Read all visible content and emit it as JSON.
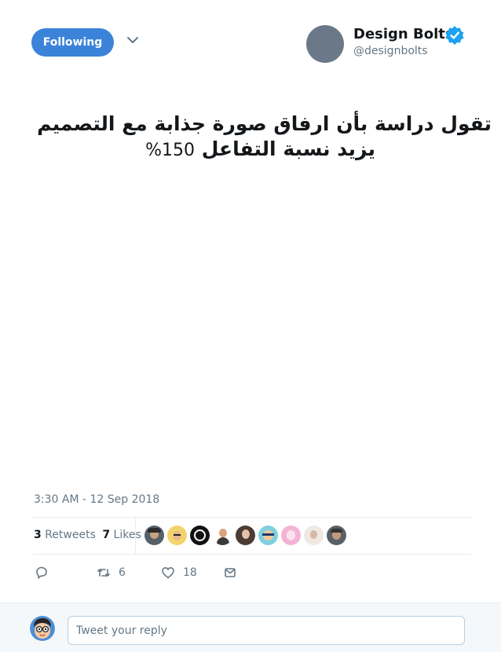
{
  "header": {
    "follow_button_label": "Following",
    "author": {
      "name": "Design Bolts",
      "handle": "@designbolts",
      "verified": true
    }
  },
  "tweet": {
    "text_line1": "تقول دراسة بأن ارفاق صورة جذابة مع التصميم",
    "text_line2": "يزيد نسبة التفاعل",
    "text_percent": "150%",
    "timestamp": "3:30 AM - 12 Sep 2018"
  },
  "stats": {
    "retweets_count": "3",
    "retweets_label": "Retweets",
    "likes_count": "7",
    "likes_label": "Likes"
  },
  "likers": [
    {
      "name": "liker-avatar-1"
    },
    {
      "name": "liker-avatar-2"
    },
    {
      "name": "liker-avatar-3"
    },
    {
      "name": "liker-avatar-4"
    },
    {
      "name": "liker-avatar-5"
    },
    {
      "name": "liker-avatar-6"
    },
    {
      "name": "liker-avatar-7"
    },
    {
      "name": "liker-avatar-8"
    },
    {
      "name": "liker-avatar-9"
    }
  ],
  "actions": {
    "reply_icon": "reply-icon",
    "retweet_icon": "retweet-icon",
    "retweet_count": "6",
    "like_icon": "heart-icon",
    "like_count": "18",
    "message_icon": "envelope-icon"
  },
  "reply": {
    "placeholder": "Tweet your reply"
  },
  "colors": {
    "accent": "#3b83d9",
    "verified": "#1da1f2",
    "muted_text": "#657786",
    "divider": "#e6ecf0"
  }
}
